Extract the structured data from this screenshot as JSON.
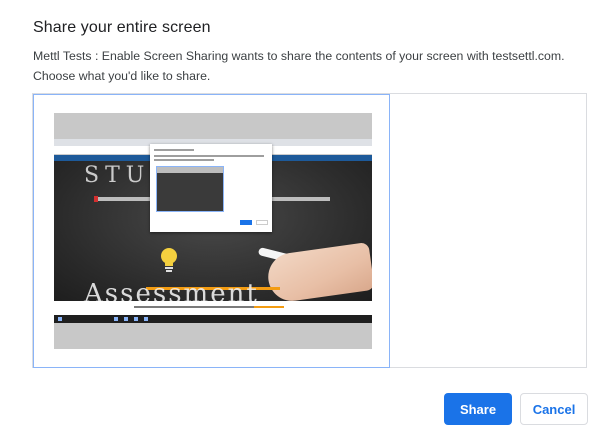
{
  "dialog": {
    "title": "Share your entire screen",
    "message": "Mettl Tests : Enable Screen Sharing wants to share the contents of your screen with testsettl.com. Choose what you'd like to share."
  },
  "thumbnail": {
    "chalk_top": "STUDE",
    "chalk_bottom": "Assessment"
  },
  "buttons": {
    "share": "Share",
    "cancel": "Cancel"
  },
  "colors": {
    "accent": "#1a73e8",
    "selection_border": "#8ab4f8"
  }
}
